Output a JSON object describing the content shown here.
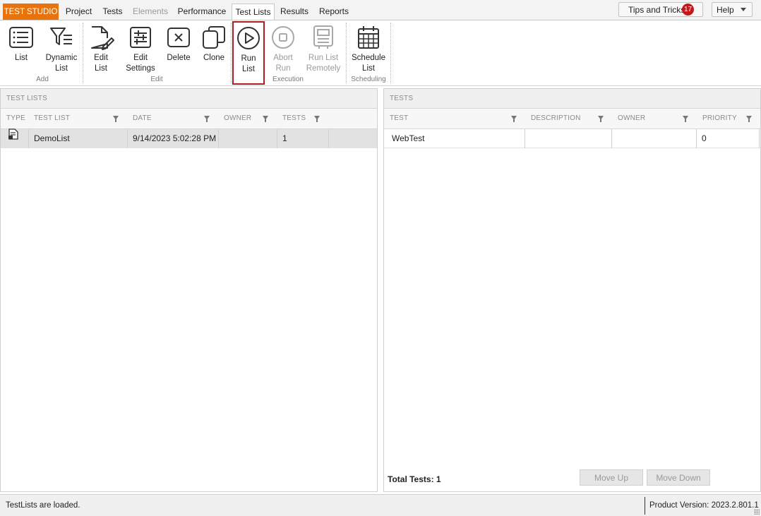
{
  "brand": "TEST STUDIO",
  "menu_tabs": [
    "Project",
    "Tests",
    "Elements",
    "Performance",
    "Test Lists",
    "Results",
    "Reports"
  ],
  "tips": {
    "label": "Tips and Tricks",
    "count": "17"
  },
  "help": {
    "label": "Help"
  },
  "ribbon": {
    "buttons": {
      "list": "List",
      "dynamic_list": "Dynamic\nList",
      "edit_list": "Edit\nList",
      "edit_settings": "Edit\nSettings",
      "delete": "Delete",
      "clone": "Clone",
      "run_list": "Run\nList",
      "abort_run": "Abort\nRun",
      "run_remotely": "Run List\nRemotely",
      "schedule_list": "Schedule\nList"
    },
    "groups": {
      "add": "Add",
      "edit": "Edit",
      "execution": "Execution",
      "scheduling": "Scheduling"
    }
  },
  "test_lists_panel": {
    "title": "TEST LISTS",
    "columns": [
      "TYPE",
      "TEST LIST",
      "DATE",
      "OWNER",
      "TESTS"
    ],
    "rows": [
      {
        "type_icon": "test-list-icon",
        "name": "DemoList",
        "date": "9/14/2023 5:02:28 PM",
        "owner": "",
        "tests": "1"
      }
    ]
  },
  "tests_panel": {
    "title": "TESTS",
    "columns": [
      "TEST",
      "DESCRIPTION",
      "OWNER",
      "PRIORITY"
    ],
    "rows": [
      {
        "test": "WebTest",
        "description": "",
        "owner": "",
        "priority": "0"
      }
    ],
    "total_label": "Total Tests: 1",
    "move_up": "Move Up",
    "move_down": "Move Down"
  },
  "status": {
    "message": "TestLists are loaded.",
    "version": "Product Version: 2023.2.801.1"
  },
  "colors": {
    "brand": "#e8730c",
    "badge": "#c3191c",
    "highlight": "#b01e23"
  }
}
